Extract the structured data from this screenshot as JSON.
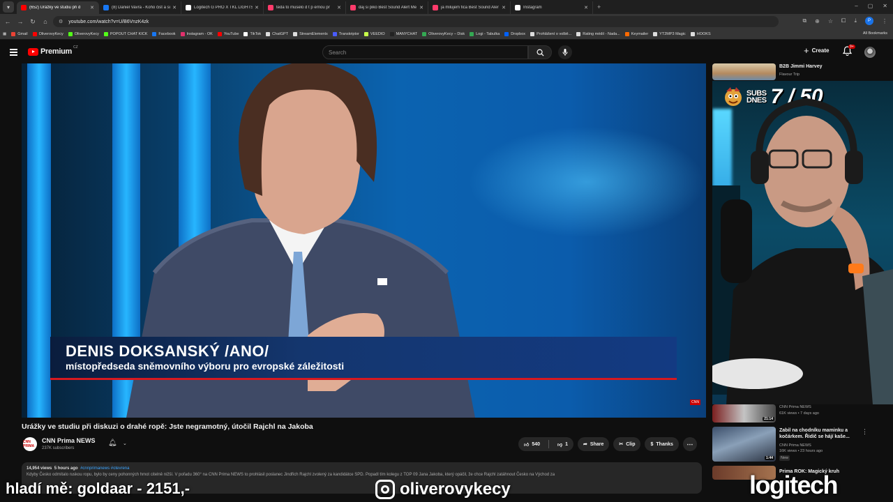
{
  "browser": {
    "tabs": [
      {
        "label": "(652) Urážky ve studiu při d",
        "color": "#ff0000",
        "active": true
      },
      {
        "label": "(8) Daniel Vavra - Koho čist a si",
        "color": "#1877f2",
        "active": false
      },
      {
        "label": "Logitech G PRO X TKL LIGHTSP",
        "color": "#ffffff",
        "active": false
      },
      {
        "label": "teda to muselo d t p ernou pr",
        "color": "#ff3b6b",
        "active": false
      },
      {
        "label": "daj si piko Best Sound Alert Me",
        "color": "#ff3b6b",
        "active": false
      },
      {
        "label": "ja milujem fica Best Sound Aler",
        "color": "#ff3b6b",
        "active": false
      },
      {
        "label": "Instagram",
        "color": "#ffffff",
        "active": false
      }
    ],
    "url": "youtube.com/watch?v=U/B6VnzK4zk",
    "profile_initial": "P",
    "bookmarks": [
      {
        "label": "Gmail",
        "color": "#ea4335"
      },
      {
        "label": "OliverovyKecy",
        "color": "#ff0000"
      },
      {
        "label": "OliverovyKecy",
        "color": "#53fc18"
      },
      {
        "label": "POPOUT CHAT KICK",
        "color": "#53fc18"
      },
      {
        "label": "Facebook",
        "color": "#1877f2"
      },
      {
        "label": "Instagram - OK",
        "color": "#e1306c"
      },
      {
        "label": "YouTube",
        "color": "#ff0000"
      },
      {
        "label": "TikTok",
        "color": "#ffffff"
      },
      {
        "label": "ChatGPT",
        "color": "#dddddd"
      },
      {
        "label": "StreamElements",
        "color": "#dddddd"
      },
      {
        "label": "Transkriptor",
        "color": "#4a5cff"
      },
      {
        "label": "VEEDIO",
        "color": "#c7ff4a"
      },
      {
        "label": "MANYCHAT",
        "color": "#222222"
      },
      {
        "label": "OliverovyKecy – Disk",
        "color": "#34a853"
      },
      {
        "label": "Logi - Tabulka",
        "color": "#34a853"
      },
      {
        "label": "Dropbox",
        "color": "#0061ff"
      },
      {
        "label": "Prohlášení o volbě...",
        "color": "#dddddd"
      },
      {
        "label": "Rating médií - Nada...",
        "color": "#dddddd"
      },
      {
        "label": "Keymailer",
        "color": "#ff6a00"
      },
      {
        "label": "YT2MP3 Magic",
        "color": "#dddddd"
      },
      {
        "label": "HOOKS",
        "color": "#dddddd"
      }
    ],
    "all_bookmarks": "All Bookmarks"
  },
  "youtube": {
    "logo": "Premium",
    "country": "CZ",
    "search_placeholder": "Search",
    "create": "Create",
    "notifications": "9+"
  },
  "video": {
    "title": "Urážky ve studiu při diskuzi o drahé ropě: Jste negramotný, útočil Rajchl na Jakoba",
    "lower_third_name": "DENIS DOKSANSKÝ /ANO/",
    "lower_third_role": "místopředseda sněmovního výboru pro evropské záležitosti",
    "channel": {
      "name": "CNN Prima NEWS",
      "subs": "237K subscribers",
      "avatar_text": "CNN PRIMA"
    },
    "likes": "540",
    "dislikes": "1",
    "share": "Share",
    "clip": "Clip",
    "thanks": "Thanks",
    "description": {
      "views": "14,954 views",
      "age": "5 hours ago",
      "tags": "#cnnprimanews #otevrena",
      "text": "Kdyby Česko odmítalo ruskou ropu, bylo by ceny pohonných hmot citelně nižší. V pořadu 360° na CNN Prima NEWS to prohlásil poslanec Jindřich Rajchl zvolený za kandidátce SPD. Popadl tím kolegu z TOP 09 Jana Jakoba, který opáčil, že chce Rajchl zatáhnout Česko na Východ za"
    }
  },
  "sidebar": {
    "top": {
      "title": "B2B Jimmi Harvey",
      "channel": "Flavour Trip"
    },
    "items": [
      {
        "title": "",
        "channel": "CNN Prima NEWS",
        "meta": "61K views • 7 days ago",
        "duration": "21:14"
      },
      {
        "title": "Zabil na chodníku maminku a kočárkem. Řidič se hájí kaše...",
        "channel": "CNN Prima NEWS",
        "meta": "16K views • 23 hours ago",
        "badge": "New",
        "duration": "1:44"
      },
      {
        "title": "Prima ROK: Magický kruh",
        "channel": "",
        "meta": "",
        "duration": ""
      }
    ]
  },
  "stream_overlay": {
    "subs_label_1": "SUBS",
    "subs_label_2": "DNES",
    "subs_count": "7 / 50",
    "donation": "hladí mě: goldaar - 2151,-",
    "instagram": "oliverovykecy",
    "sponsor": "logitech"
  }
}
